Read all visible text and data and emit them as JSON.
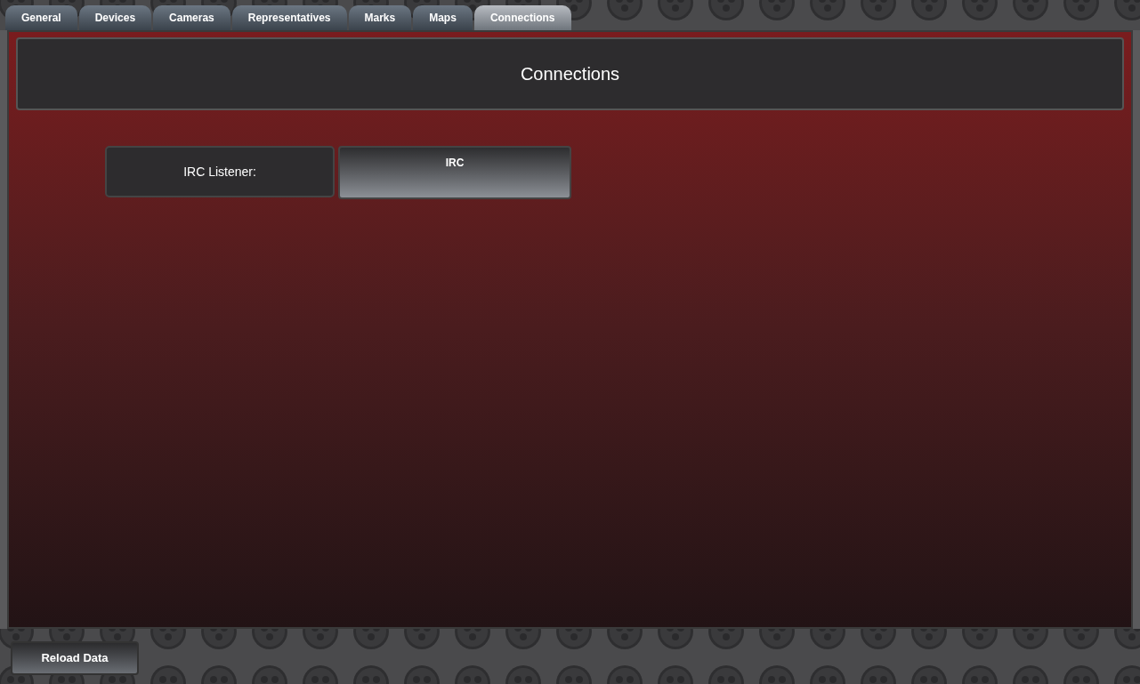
{
  "tabs": [
    {
      "label": "General",
      "selected": false
    },
    {
      "label": "Devices",
      "selected": false
    },
    {
      "label": "Cameras",
      "selected": false
    },
    {
      "label": "Representatives",
      "selected": false
    },
    {
      "label": "Marks",
      "selected": false
    },
    {
      "label": "Maps",
      "selected": false
    },
    {
      "label": "Connections",
      "selected": true
    }
  ],
  "header": {
    "title": "Connections"
  },
  "settings": [
    {
      "label": "IRC Listener:",
      "button": "IRC"
    }
  ],
  "footer": {
    "button": "Reload Data"
  }
}
